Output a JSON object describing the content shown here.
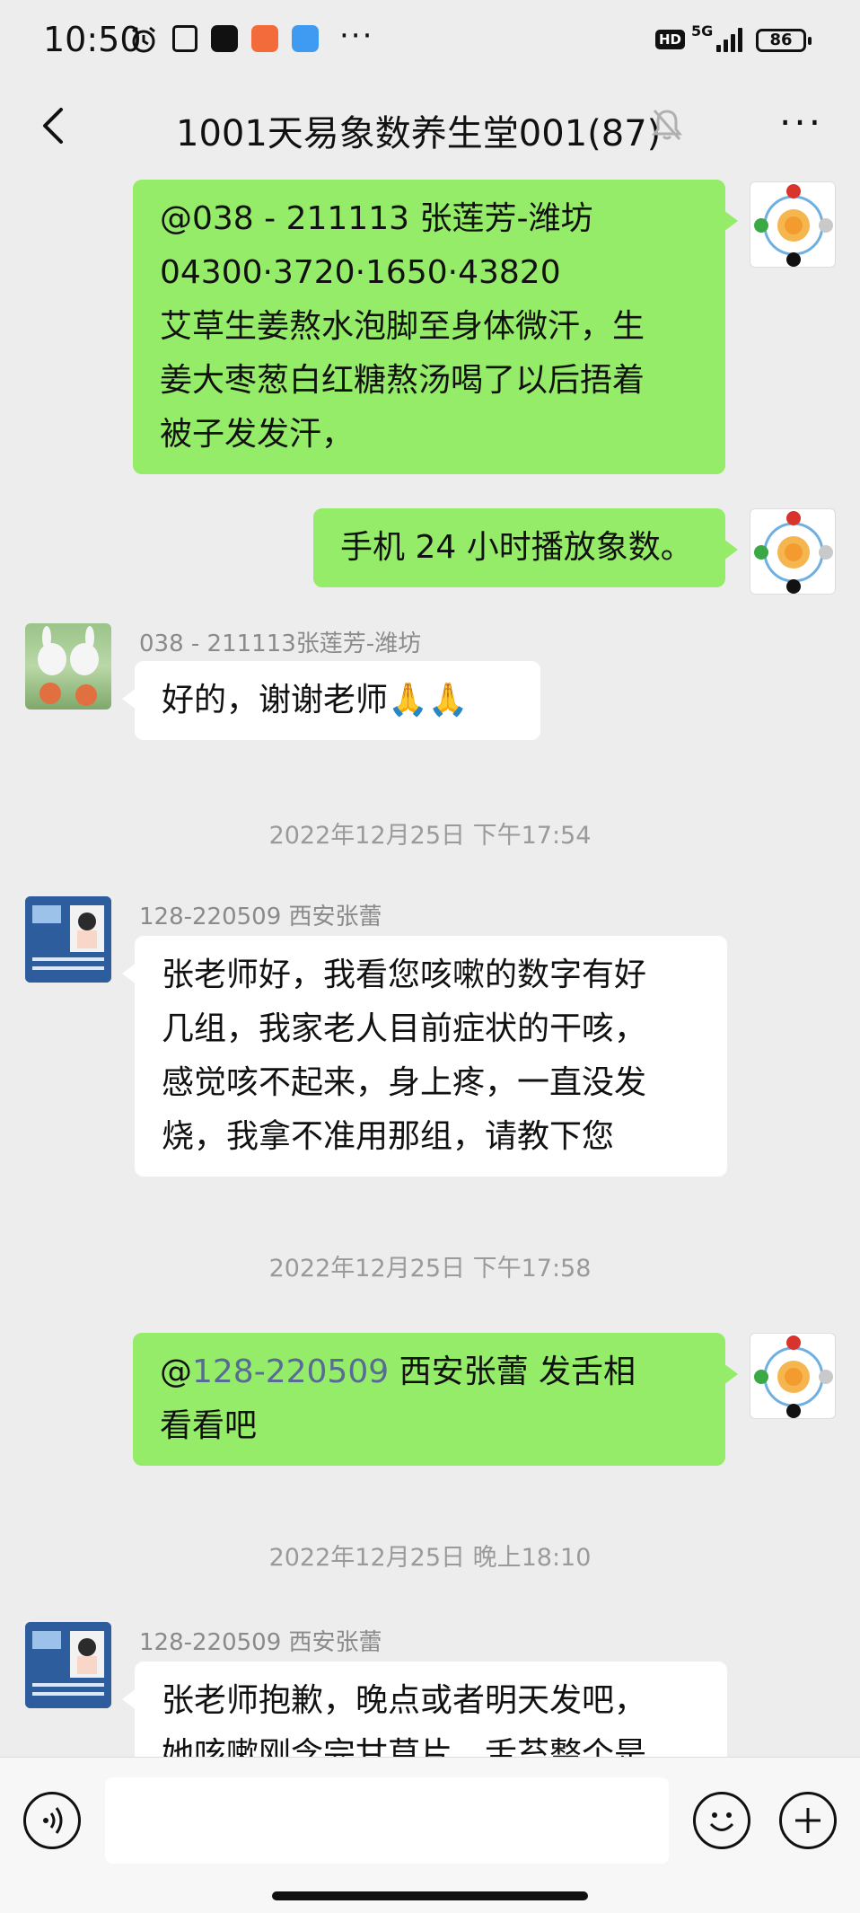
{
  "status_bar": {
    "time": "10:50",
    "network": "5G",
    "hd": "HD",
    "battery": "86",
    "more": "···"
  },
  "header": {
    "title": "1001天易象数养生堂001(87)",
    "more": "···"
  },
  "messages": [
    {
      "lines": [
        "@038 - 211113 张莲芳-潍坊",
        "04300·3720·1650·43820",
        "艾草生姜熬水泡脚至身体微汗，生",
        "姜大枣葱白红糖熬汤喝了以后捂着",
        "被子发发汗，"
      ]
    },
    {
      "lines": [
        "手机 24 小时播放象数。"
      ]
    },
    {
      "sender": "038 - 211113张莲芳-潍坊",
      "lines": [
        "好的，谢谢老师🙏🙏"
      ]
    },
    {
      "timestamp": "2022年12月25日 下午17:54"
    },
    {
      "sender": "128-220509 西安张蕾",
      "lines": [
        "张老师好，我看您咳嗽的数字有好",
        "几组，我家老人目前症状的干咳，",
        "感觉咳不起来，身上疼，一直没发",
        "烧，我拿不准用那组，请教下您"
      ]
    },
    {
      "timestamp": "2022年12月25日 下午17:58"
    },
    {
      "at": "@",
      "mention": "128-220509",
      "rest": " 西安张蕾  发舌相",
      "line2": "看看吧"
    },
    {
      "timestamp": "2022年12月25日 晚上18:10"
    },
    {
      "sender": "128-220509 西安张蕾",
      "lines": [
        "张老师抱歉，晚点或者明天发吧，",
        "她咳嗽刚含完甘草片，舌苔整个是"
      ]
    }
  ],
  "input_bar": {
    "voice_icon": "voice-icon",
    "emoji_icon": "emoji-icon",
    "plus_icon": "plus-icon"
  },
  "colors": {
    "self_bubble": "#95ec69",
    "other_bubble": "#ffffff",
    "background": "#ededed",
    "mention": "#576b95"
  }
}
